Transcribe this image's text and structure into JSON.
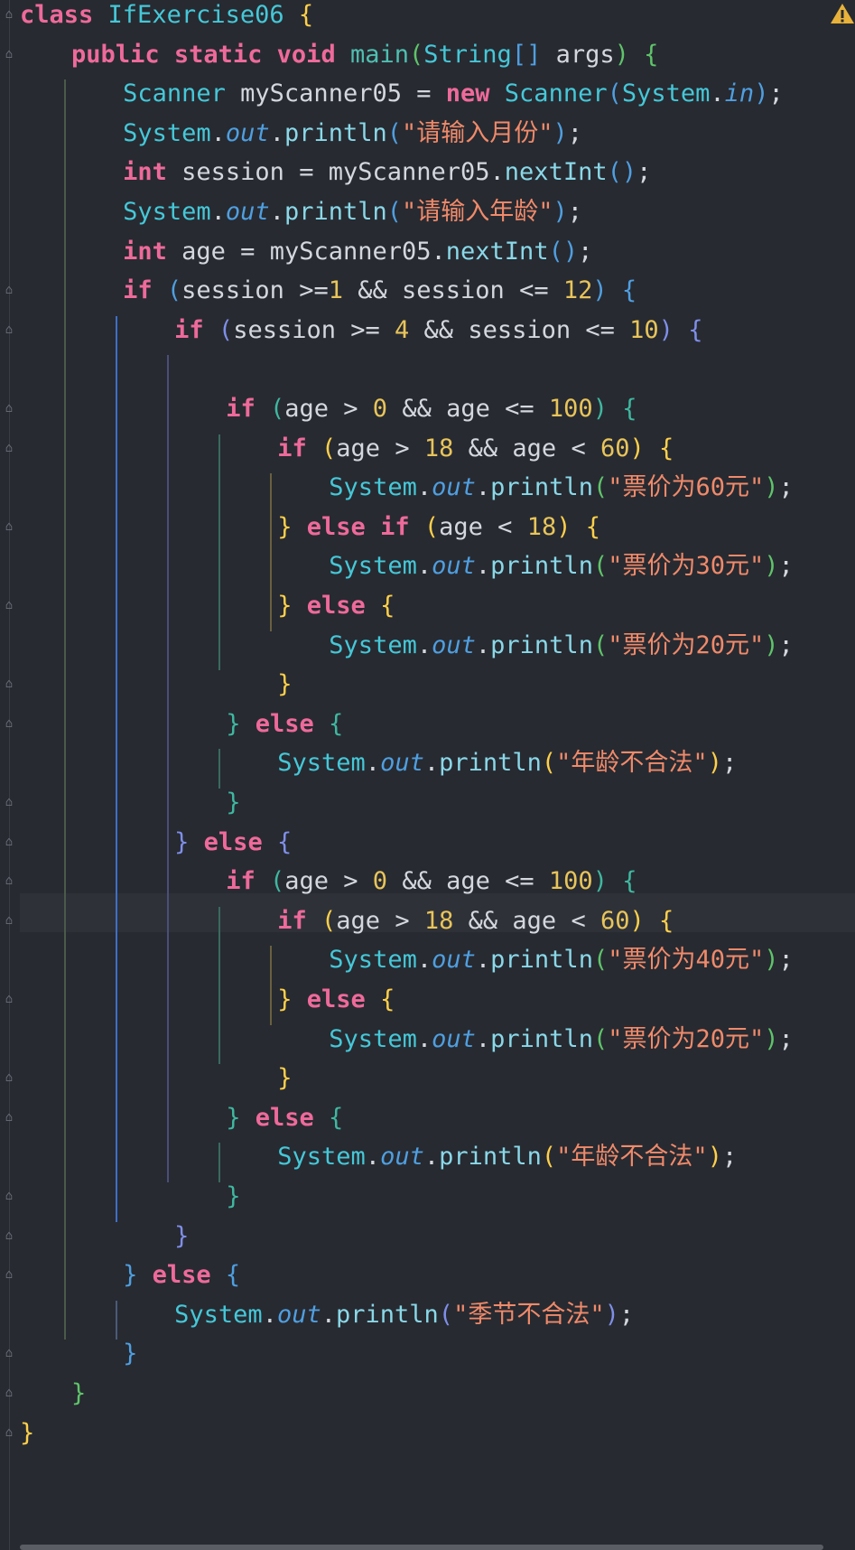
{
  "editor": {
    "lines": [
      "class IfExercise06 {",
      "public static void main(String[] args) {",
      "Scanner myScanner05 = new Scanner(System.in);",
      "System.out.println(\"请输入月份\");",
      "int session = myScanner05.nextInt();",
      "System.out.println(\"请输入年龄\");",
      "int age = myScanner05.nextInt();",
      "if (session >=1 && session <= 12) {",
      "if (session >= 4 && session <= 10) {",
      "",
      "if (age > 0 && age <= 100) {",
      "if (age > 18 && age < 60) {",
      "System.out.println(\"票价为60元\");",
      "} else if (age < 18) {",
      "System.out.println(\"票价为30元\");",
      "} else {",
      "System.out.println(\"票价为20元\");",
      "}",
      "} else {",
      "System.out.println(\"年龄不合法\");",
      "}",
      "} else {",
      "if (age > 0 && age <= 100) {",
      "if (age > 18 && age < 60) {",
      "System.out.println(\"票价为40元\");",
      "} else {",
      "System.out.println(\"票价为20元\");",
      "}",
      "} else {",
      "System.out.println(\"年龄不合法\");",
      "}",
      "}",
      "} else {",
      "System.out.println(\"季节不合法\");",
      "}",
      "}",
      "}"
    ],
    "warning_icon": "warning-icon",
    "colors": {
      "background": "#272a31",
      "keyword": "#ee6a9a",
      "type": "#45c8d8",
      "string": "#f08a6a",
      "number": "#e8c45a"
    }
  }
}
